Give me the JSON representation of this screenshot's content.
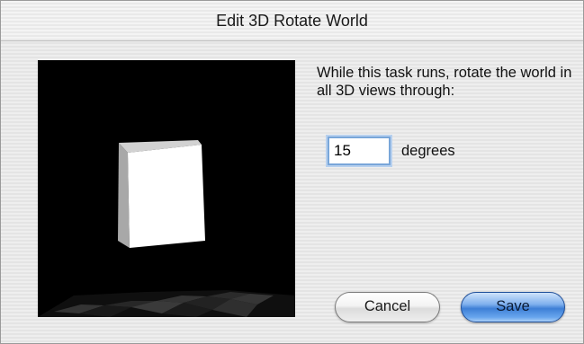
{
  "window": {
    "title": "Edit 3D Rotate World"
  },
  "instruction": {
    "text": "While this task runs, rotate the world in all 3D views through:"
  },
  "rotation": {
    "value": "15",
    "unit_label": "degrees"
  },
  "buttons": {
    "cancel_label": "Cancel",
    "save_label": "Save"
  },
  "colors": {
    "default_button": "#3e7fd6",
    "focus_ring": "#79a6d9",
    "preview_background": "#000000"
  }
}
